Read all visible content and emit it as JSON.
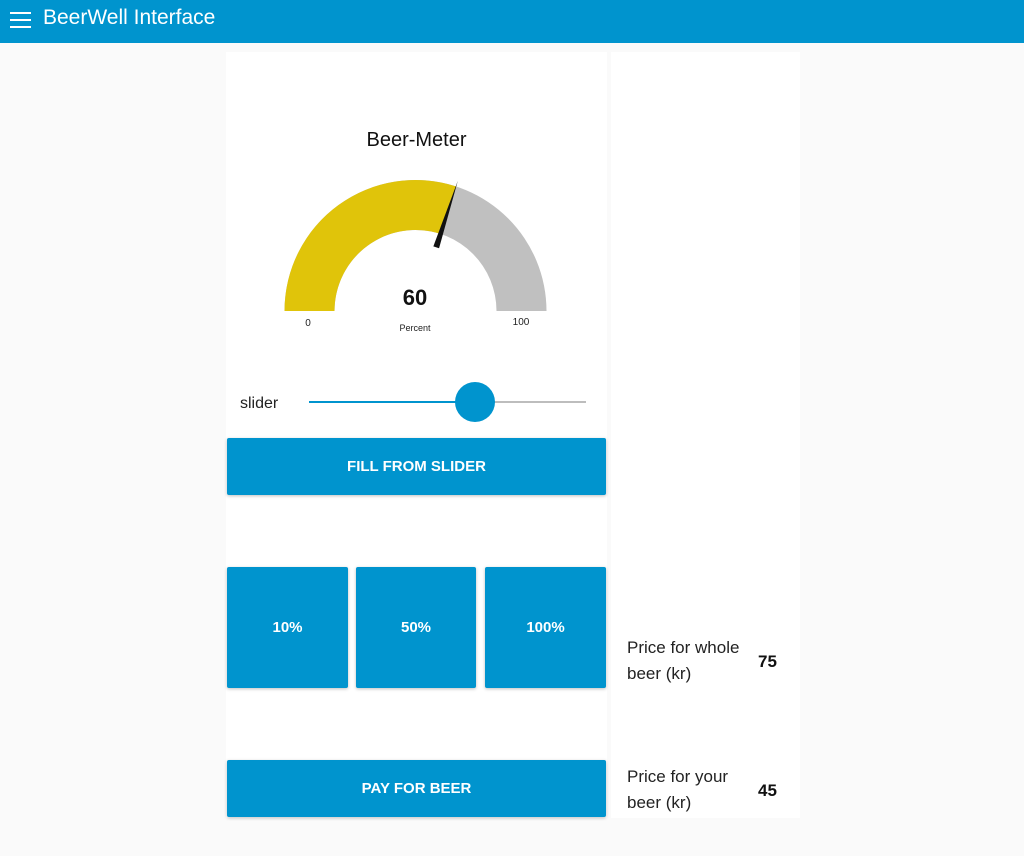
{
  "header": {
    "title": "BeerWell Interface",
    "menu_icon": "hamburger-menu-icon",
    "color": "#0094ce"
  },
  "gauge": {
    "title": "Beer-Meter",
    "value": 60,
    "value_label": "60",
    "units": "Percent",
    "min_label": "0",
    "max_label": "100",
    "min": 0,
    "max": 100,
    "fill_color": "#e0c40a",
    "bg_color": "#c0c0c0"
  },
  "slider": {
    "label": "slider",
    "value": 60,
    "min": 0,
    "max": 100
  },
  "buttons": {
    "fill_from_slider": "FILL FROM SLIDER",
    "ten": "10%",
    "fifty": "50%",
    "hundred": "100%",
    "pay": "PAY FOR BEER"
  },
  "prices": {
    "whole_label": "Price for whole beer (kr)",
    "whole_value": "75",
    "yours_label": "Price for your beer (kr)",
    "yours_value": "45"
  }
}
